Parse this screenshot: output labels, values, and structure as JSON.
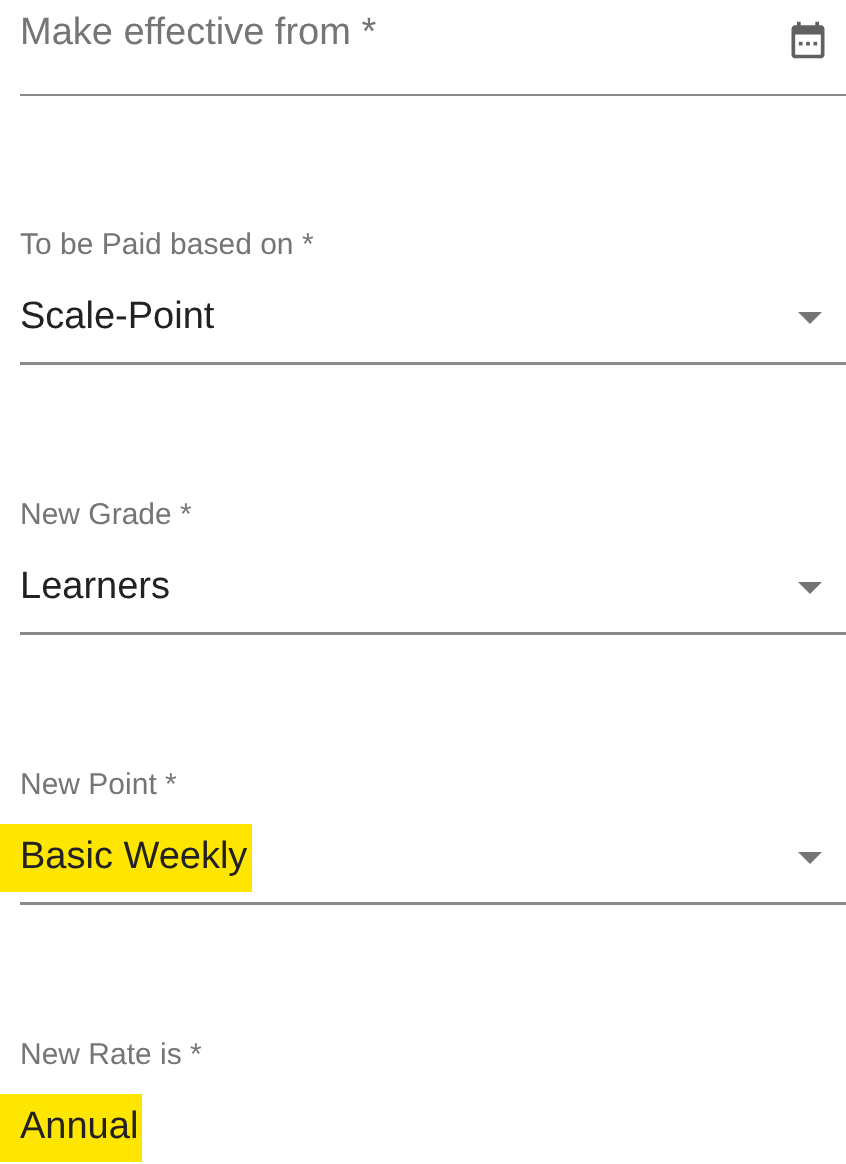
{
  "fields": [
    {
      "kind": "date",
      "placeholder": "Make effective from *"
    },
    {
      "kind": "select",
      "label": "To be Paid based on *",
      "value": "Scale-Point",
      "highlighted": false
    },
    {
      "kind": "select",
      "label": "New Grade *",
      "value": "Learners",
      "highlighted": false
    },
    {
      "kind": "select",
      "label": "New Point *",
      "value": "Basic Weekly",
      "highlighted": true
    },
    {
      "kind": "text",
      "label": "New Rate is *",
      "value": "Annual",
      "highlighted": true
    }
  ]
}
